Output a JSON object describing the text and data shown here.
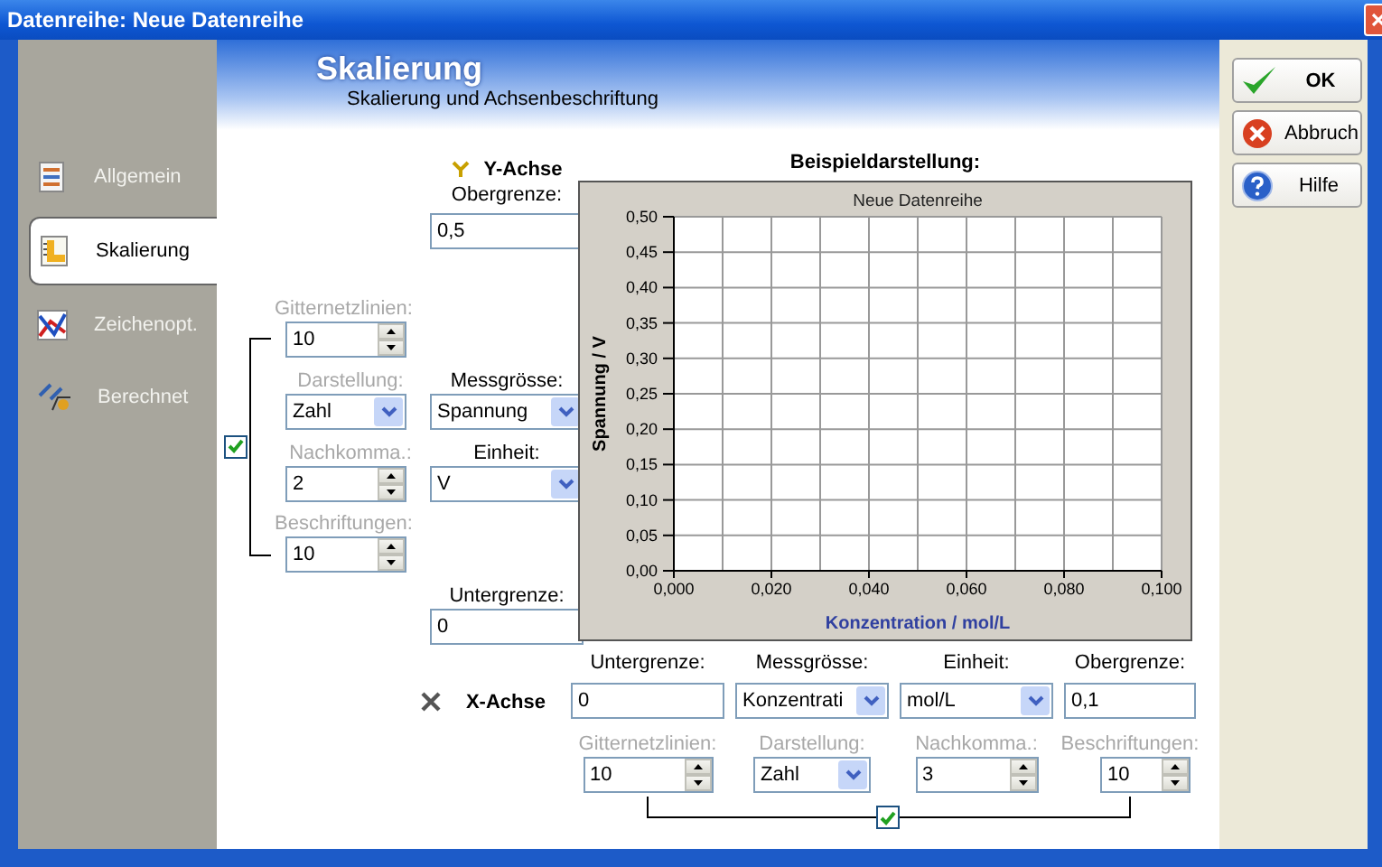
{
  "window": {
    "title": "Datenreihe: Neue Datenreihe"
  },
  "sidebar": {
    "items": [
      {
        "label": "Allgemein",
        "selected": false
      },
      {
        "label": "Skalierung",
        "selected": true
      },
      {
        "label": "Zeichenopt.",
        "selected": false
      },
      {
        "label": "Berechnet",
        "selected": false
      }
    ]
  },
  "header": {
    "title": "Skalierung",
    "subtitle": "Skalierung und Achsenbeschriftung"
  },
  "y_axis": {
    "label": "Y-Achse",
    "upper": {
      "label": "Obergrenze:",
      "value": "0,5"
    },
    "grid_lines": {
      "label": "Gitternetzlinien:",
      "value": "10",
      "disabled": true
    },
    "display": {
      "label": "Darstellung:",
      "value": "Zahl",
      "disabled": true
    },
    "quantity": {
      "label": "Messgrösse:",
      "value": "Spannung",
      "disabled": false
    },
    "decimals": {
      "label": "Nachkomma.:",
      "value": "2",
      "disabled": true
    },
    "unit": {
      "label": "Einheit:",
      "value": "V",
      "disabled": false
    },
    "labels": {
      "label": "Beschriftungen:",
      "value": "10",
      "disabled": true
    },
    "auto_checked": true,
    "lower": {
      "label": "Untergrenze:",
      "value": "0"
    }
  },
  "chart": {
    "heading": "Beispieldarstellung:",
    "chart_data": {
      "type": "line",
      "grid": true,
      "title": "Neue Datenreihe",
      "xlabel": "Konzentration / mol/L",
      "ylabel": "Spannung / V",
      "xlim": [
        0,
        0.1
      ],
      "ylim": [
        0,
        0.5
      ],
      "xticks": [
        {
          "value": 0,
          "label": "0,000"
        },
        {
          "value": 0.02,
          "label": "0,020"
        },
        {
          "value": 0.04,
          "label": "0,040"
        },
        {
          "value": 0.06,
          "label": "0,060"
        },
        {
          "value": 0.08,
          "label": "0,080"
        },
        {
          "value": 0.1,
          "label": "0,100"
        }
      ],
      "yticks": [
        {
          "value": 0,
          "label": "0,00"
        },
        {
          "value": 0.05,
          "label": "0,05"
        },
        {
          "value": 0.1,
          "label": "0,10"
        },
        {
          "value": 0.15,
          "label": "0,15"
        },
        {
          "value": 0.2,
          "label": "0,20"
        },
        {
          "value": 0.25,
          "label": "0,25"
        },
        {
          "value": 0.3,
          "label": "0,30"
        },
        {
          "value": 0.35,
          "label": "0,35"
        },
        {
          "value": 0.4,
          "label": "0,40"
        },
        {
          "value": 0.45,
          "label": "0,45"
        },
        {
          "value": 0.5,
          "label": "0,50"
        }
      ]
    }
  },
  "x_axis": {
    "label": "X-Achse",
    "lower": {
      "label": "Untergrenze:",
      "value": "0"
    },
    "quantity": {
      "label": "Messgrösse:",
      "value": "Konzentrati",
      "disabled": false
    },
    "unit": {
      "label": "Einheit:",
      "value": "mol/L",
      "disabled": false
    },
    "upper": {
      "label": "Obergrenze:",
      "value": "0,1"
    },
    "grid_lines": {
      "label": "Gitternetzlinien:",
      "value": "10",
      "disabled": true
    },
    "display": {
      "label": "Darstellung:",
      "value": "Zahl",
      "disabled": true
    },
    "decimals": {
      "label": "Nachkomma.:",
      "value": "3",
      "disabled": true
    },
    "labels": {
      "label": "Beschriftungen:",
      "value": "10",
      "disabled": true
    },
    "auto_checked": true
  },
  "buttons": [
    {
      "label": "OK"
    },
    {
      "label": "Abbruch"
    },
    {
      "label": "Hilfe"
    }
  ]
}
